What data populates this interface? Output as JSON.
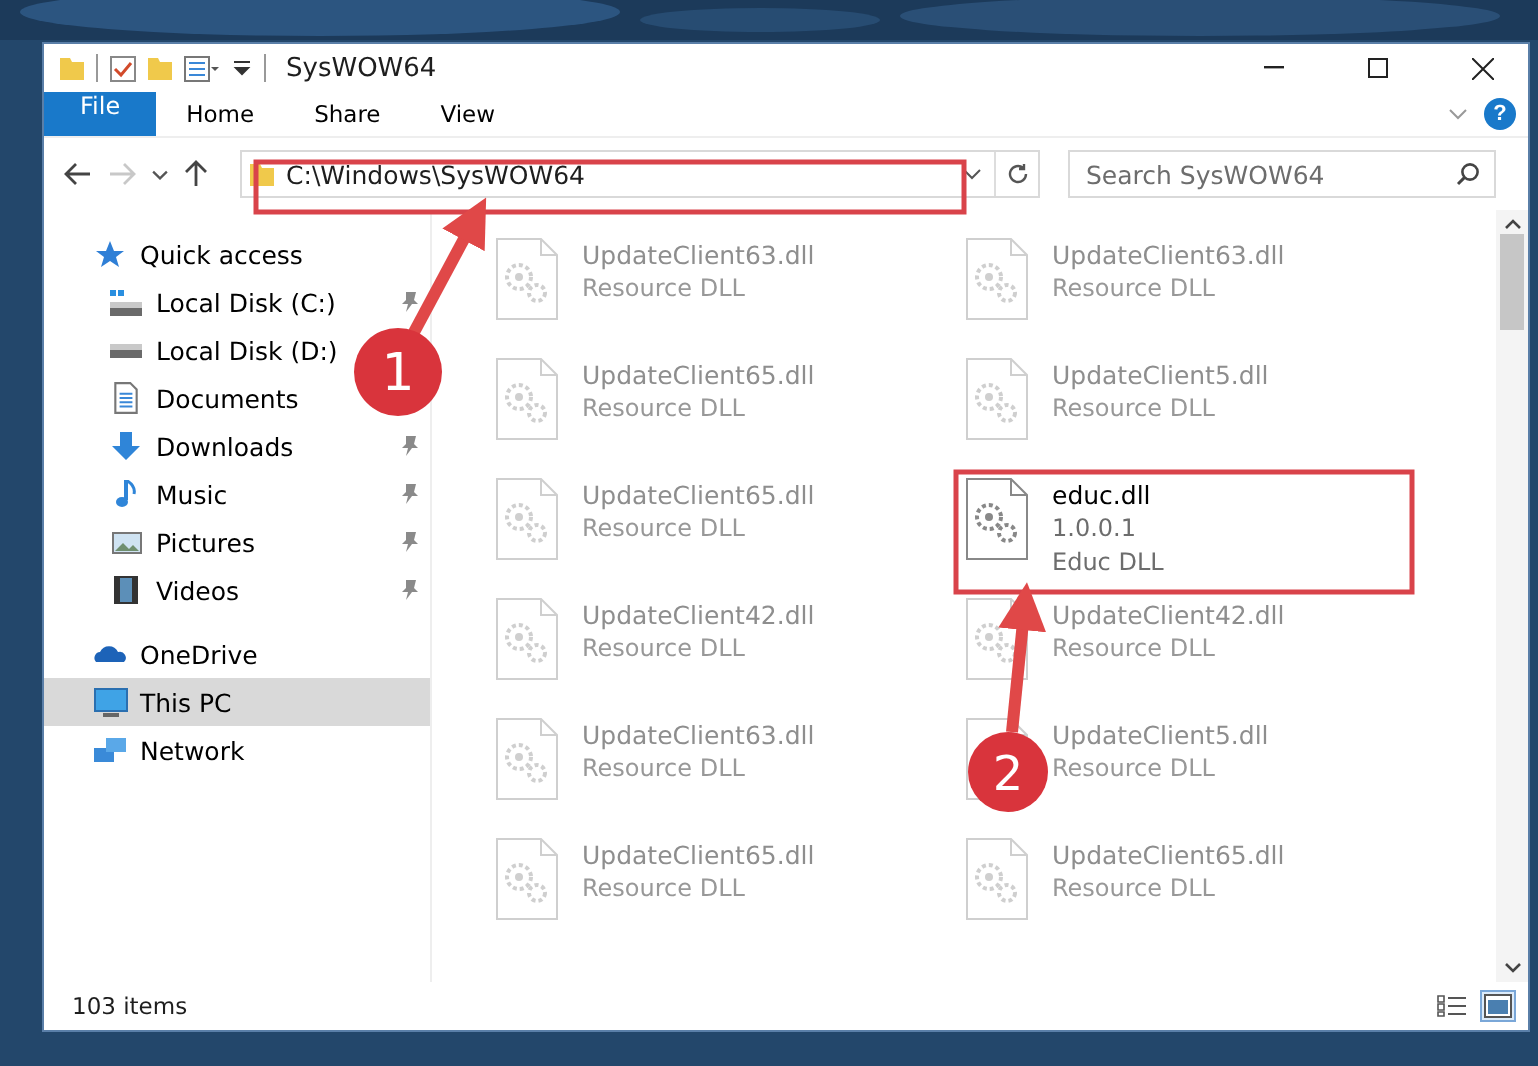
{
  "window": {
    "title": "SysWOW64"
  },
  "ribbon": {
    "tabs": [
      {
        "label": "File",
        "kind": "file"
      },
      {
        "label": "Home",
        "kind": "tab"
      },
      {
        "label": "Share",
        "kind": "tab"
      },
      {
        "label": "View",
        "kind": "tab"
      }
    ],
    "help": "?"
  },
  "navigation": {
    "forward_disabled": true
  },
  "address_bar": {
    "path": "C:\\Windows\\SysWOW64"
  },
  "search": {
    "placeholder": "Search SysWOW64"
  },
  "sidebar": {
    "items": [
      {
        "label": "Quick access",
        "selected": false,
        "children": [
          {
            "label": "Local Disk (C:)",
            "pinned": true,
            "selected": false
          },
          {
            "label": "Local Disk (D:)",
            "selected": false
          },
          {
            "label": "Documents",
            "selected": false
          },
          {
            "label": "Downloads",
            "pinned": true,
            "selected": false
          },
          {
            "label": "Music",
            "pinned": true,
            "selected": false
          },
          {
            "label": "Pictures",
            "pinned": true,
            "selected": false
          },
          {
            "label": "Videos",
            "pinned": true,
            "selected": false
          }
        ]
      },
      {
        "label": "OneDrive",
        "selected": false
      },
      {
        "label": "This PC",
        "selected": true
      },
      {
        "label": "Network",
        "selected": false
      }
    ]
  },
  "files": [
    {
      "name": "UpdateClient63.dll",
      "details": [
        "Resource DLL"
      ],
      "dimmed": true
    },
    {
      "name": "UpdateClient63.dll",
      "details": [
        "Resource DLL"
      ],
      "dimmed": true
    },
    {
      "name": "UpdateClient65.dll",
      "details": [
        "Resource DLL"
      ],
      "dimmed": true
    },
    {
      "name": "UpdateClient5.dll",
      "details": [
        "Resource DLL"
      ],
      "dimmed": true
    },
    {
      "name": "UpdateClient65.dll",
      "details": [
        "Resource DLL"
      ],
      "dimmed": true
    },
    {
      "name": "educ.dll",
      "details": [
        "1.0.0.1",
        "Educ DLL"
      ],
      "dimmed": false
    },
    {
      "name": "UpdateClient42.dll",
      "details": [
        "Resource DLL"
      ],
      "dimmed": true
    },
    {
      "name": "UpdateClient42.dll",
      "details": [
        "Resource DLL"
      ],
      "dimmed": true
    },
    {
      "name": "UpdateClient63.dll",
      "details": [
        "Resource DLL"
      ],
      "dimmed": true
    },
    {
      "name": "UpdateClient5.dll",
      "details": [
        "Resource DLL"
      ],
      "dimmed": true
    },
    {
      "name": "UpdateClient65.dll",
      "details": [
        "Resource DLL"
      ],
      "dimmed": true
    },
    {
      "name": "UpdateClient65.dll",
      "details": [
        "Resource DLL"
      ],
      "dimmed": true
    }
  ],
  "status_bar": {
    "count": "103 items",
    "views": [
      {
        "kind": "details",
        "selected": false
      },
      {
        "kind": "large-icons",
        "selected": true
      }
    ]
  },
  "annotations": [
    {
      "label": "1"
    },
    {
      "label": "2"
    }
  ]
}
